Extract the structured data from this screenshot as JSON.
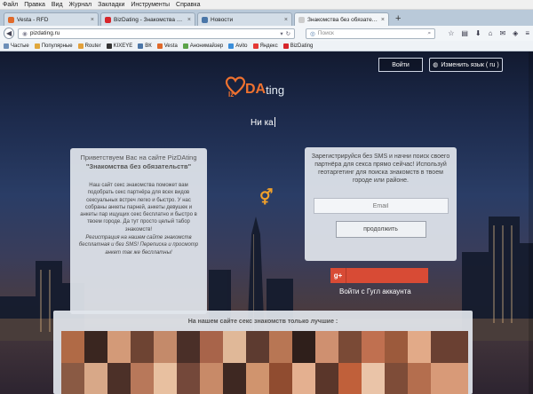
{
  "menu": [
    "Файл",
    "Правка",
    "Вид",
    "Журнал",
    "Закладки",
    "Инструменты",
    "Справка"
  ],
  "tabs": [
    {
      "label": "Vesta - RFD",
      "color": "#e06a2b",
      "active": false
    },
    {
      "label": "BizDating - Знакомства для о...",
      "color": "#d7262b",
      "active": false
    },
    {
      "label": "Новости",
      "color": "#4a76a8",
      "active": false
    },
    {
      "label": "Знакомства без обязательств - ...",
      "color": "#cccccc",
      "active": true
    }
  ],
  "url": "pizdating.ru",
  "search_placeholder": "Поиск",
  "bookmarks": [
    {
      "label": "Частые",
      "color": "#6d8fb8"
    },
    {
      "label": "Популярные",
      "color": "#e0a73b"
    },
    {
      "label": "Router",
      "color": "#e3a13a"
    },
    {
      "label": "KIXEYE",
      "color": "#333333"
    },
    {
      "label": "ВК",
      "color": "#4a76a8"
    },
    {
      "label": "Vesta",
      "color": "#e06a2b"
    },
    {
      "label": "Анонимайзер",
      "color": "#5ca44a"
    },
    {
      "label": "Avito",
      "color": "#3a8edb"
    },
    {
      "label": "Яндекс",
      "color": "#e53935"
    },
    {
      "label": "BizDating",
      "color": "#d7262b"
    }
  ],
  "site": {
    "login": "Войти",
    "lang": "Изменить язык ( ru )",
    "logo_dat": "DA",
    "logo_ting": "ting",
    "typing": "Ни ка",
    "left": {
      "h1": "Приветствуем Вас на сайте PizDAting",
      "h2": "\"Знакомства без обязательств\"",
      "p1": "Наш сайт секс знакомства поможет вам подобрать секс партнёра для всех видов сексуальных встреч легко и быстро. У нас собраны анкеты парней, анкеты девушек и анкеты пар ищущих секс бесплатно и быстро в твоем городе. Да тут просто целый табор знакомств!",
      "p2": "Регистрация на нашем сайте знакомств бесплатная и без SMS! Переписка и просмотр анкет так же бесплатны!"
    },
    "right": {
      "text": "Зарегистрируйся без SMS и начни поиск своего партнёра для секса прямо сейчас! Используй геотаргетинг для поиска знакомств в твоем городе или районе.",
      "email_placeholder": "Email",
      "continue": "продолжить"
    },
    "gplus": "g+",
    "google_label": "Войти с Гугл аккаунта",
    "photos_title": "На нашем сайте секс знакомств только лучшие :"
  },
  "accent": "#f0722f"
}
